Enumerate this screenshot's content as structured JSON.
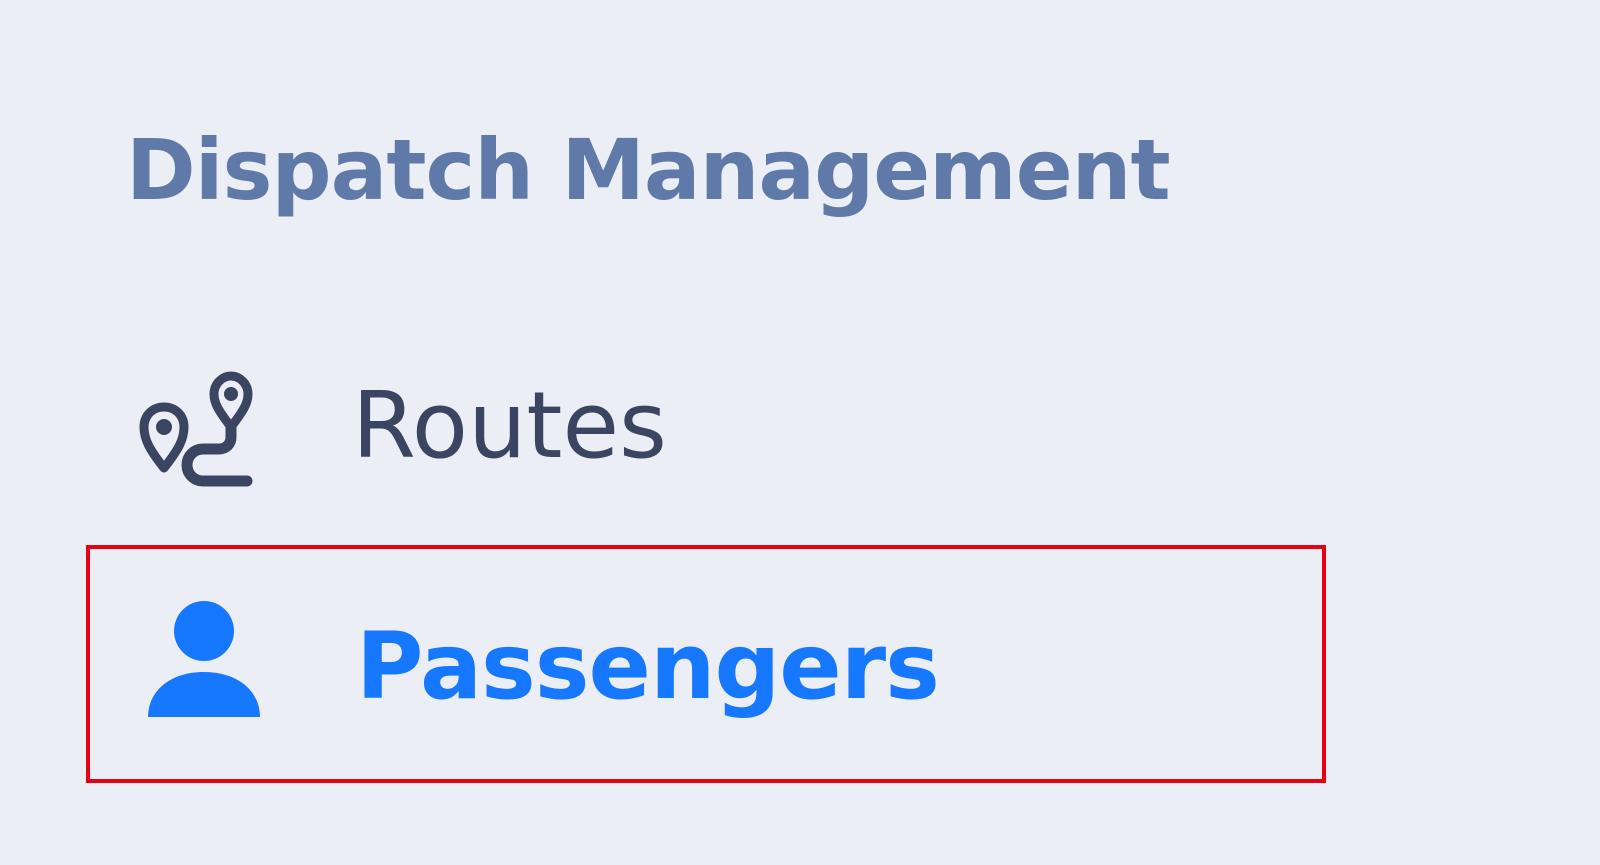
{
  "sidebar": {
    "section": {
      "title": "Dispatch Management"
    },
    "items": [
      {
        "label": "Routes",
        "icon": "route-icon",
        "selected": false
      },
      {
        "label": "Passengers",
        "icon": "person-icon",
        "selected": true
      }
    ]
  },
  "colors": {
    "background": "#ebeef5",
    "section_title": "#5f79a8",
    "default_item": "#3a4661",
    "active_item": "#1677ff",
    "highlight_border": "#e60012"
  }
}
